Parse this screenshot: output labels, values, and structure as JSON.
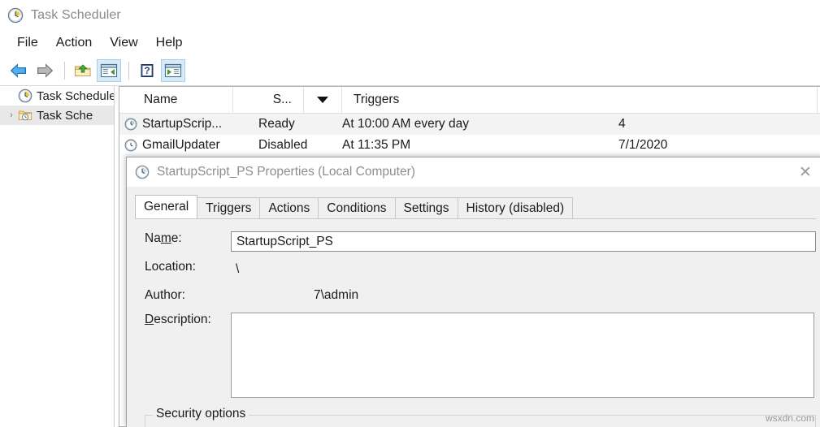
{
  "window": {
    "title": "Task Scheduler",
    "icon": "clock-icon"
  },
  "menu": {
    "items": [
      {
        "label": "File"
      },
      {
        "label": "Action"
      },
      {
        "label": "View"
      },
      {
        "label": "Help"
      }
    ]
  },
  "toolbar": {
    "buttons": [
      {
        "name": "back-button",
        "icon": "arrow-left-icon",
        "toggled": false
      },
      {
        "name": "forward-button",
        "icon": "arrow-right-icon",
        "toggled": false
      },
      {
        "name": "show-hide-console-tree-button",
        "icon": "folder-up-icon",
        "toggled": false
      },
      {
        "name": "show-hide-action-pane-button",
        "icon": "pane-left-icon",
        "toggled": true
      },
      {
        "name": "help-button",
        "icon": "question-icon",
        "toggled": false
      },
      {
        "name": "show-hide-preview-pane-button",
        "icon": "pane-right-icon",
        "toggled": true
      }
    ]
  },
  "tree": {
    "items": [
      {
        "label": "Task Schedule",
        "icon": "clock-icon",
        "expander": "",
        "selected": false,
        "indent": 0
      },
      {
        "label": "Task Sche",
        "icon": "folder-clock-icon",
        "expander": "›",
        "selected": true,
        "indent": 1
      }
    ]
  },
  "list": {
    "columns": [
      {
        "label": "Name",
        "name": "column-name"
      },
      {
        "label": "S...",
        "name": "column-status"
      },
      {
        "label": "",
        "name": "column-sort-indicator"
      },
      {
        "label": "Triggers",
        "name": "column-triggers"
      }
    ],
    "rows": [
      {
        "icon": "clock-icon",
        "name": "StartupScrip...",
        "status": "Ready",
        "triggers": "At 10:00 AM every day",
        "next_run": "4"
      },
      {
        "icon": "clock-icon",
        "name": "GmailUpdater",
        "status": "Disabled",
        "triggers": "At 11:35 PM",
        "next_run": "7/1/2020"
      }
    ]
  },
  "dialog": {
    "title": "StartupScript_PS Properties (Local Computer)",
    "title_icon": "clock-icon",
    "close_label": "✕",
    "tabs": [
      {
        "label": "General",
        "active": true
      },
      {
        "label": "Triggers",
        "active": false
      },
      {
        "label": "Actions",
        "active": false
      },
      {
        "label": "Conditions",
        "active": false
      },
      {
        "label": "Settings",
        "active": false
      },
      {
        "label": "History (disabled)",
        "active": false
      }
    ],
    "fields": {
      "name_label_pre": "Na",
      "name_label_accel": "m",
      "name_label_post": "e:",
      "name_value": "StartupScript_PS",
      "location_label": "Location:",
      "location_value": "\\",
      "author_label": "Author:",
      "author_value": "7\\admin",
      "description_label_accel": "D",
      "description_label_post": "escription:",
      "description_value": ""
    },
    "security_group_label": "Security options"
  },
  "watermark": "wsxdn.com"
}
